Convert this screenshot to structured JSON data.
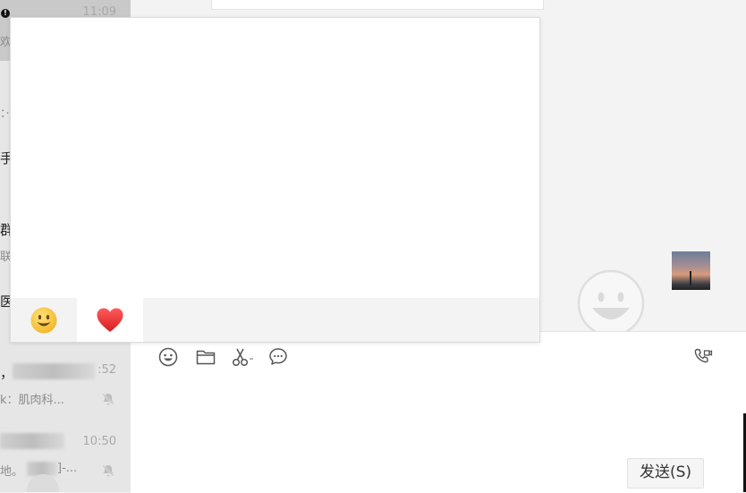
{
  "chat_list": {
    "items": [
      {
        "time": "11:09",
        "preview": "欢",
        "selected": true
      },
      {
        "preview": "：·"
      },
      {
        "title": "手"
      },
      {
        "title": "群",
        "preview": "联"
      },
      {
        "title": "医"
      },
      {
        "title": "，",
        "time": ":52",
        "preview": "k：肌肉科...",
        "muted": true
      },
      {
        "time": "10:50",
        "preview": "地。",
        "preview_tail": "]-...",
        "muted": true
      }
    ]
  },
  "emoji_panel": {
    "tabs": [
      {
        "icon": "smiley-emoji-icon",
        "glyph": "😀",
        "active": false
      },
      {
        "icon": "heart-emoji-icon",
        "glyph": "❤",
        "active": true
      }
    ]
  },
  "chat": {
    "image_thumbnail": "sunset-photo-thumbnail"
  },
  "toolbar": {
    "emoji": "smiley-icon",
    "file": "folder-icon",
    "screenshot": "scissors-icon",
    "chat_history": "chat-bubble-icon",
    "call": "video-call-icon"
  },
  "input": {
    "send_label": "发送(S)"
  },
  "colors": {
    "list_bg": "#e6e6e6",
    "selected_bg": "#c9c9c9",
    "chat_bg": "#f3f3f3",
    "heart": "#e53935",
    "smiley": "#f7c948"
  }
}
